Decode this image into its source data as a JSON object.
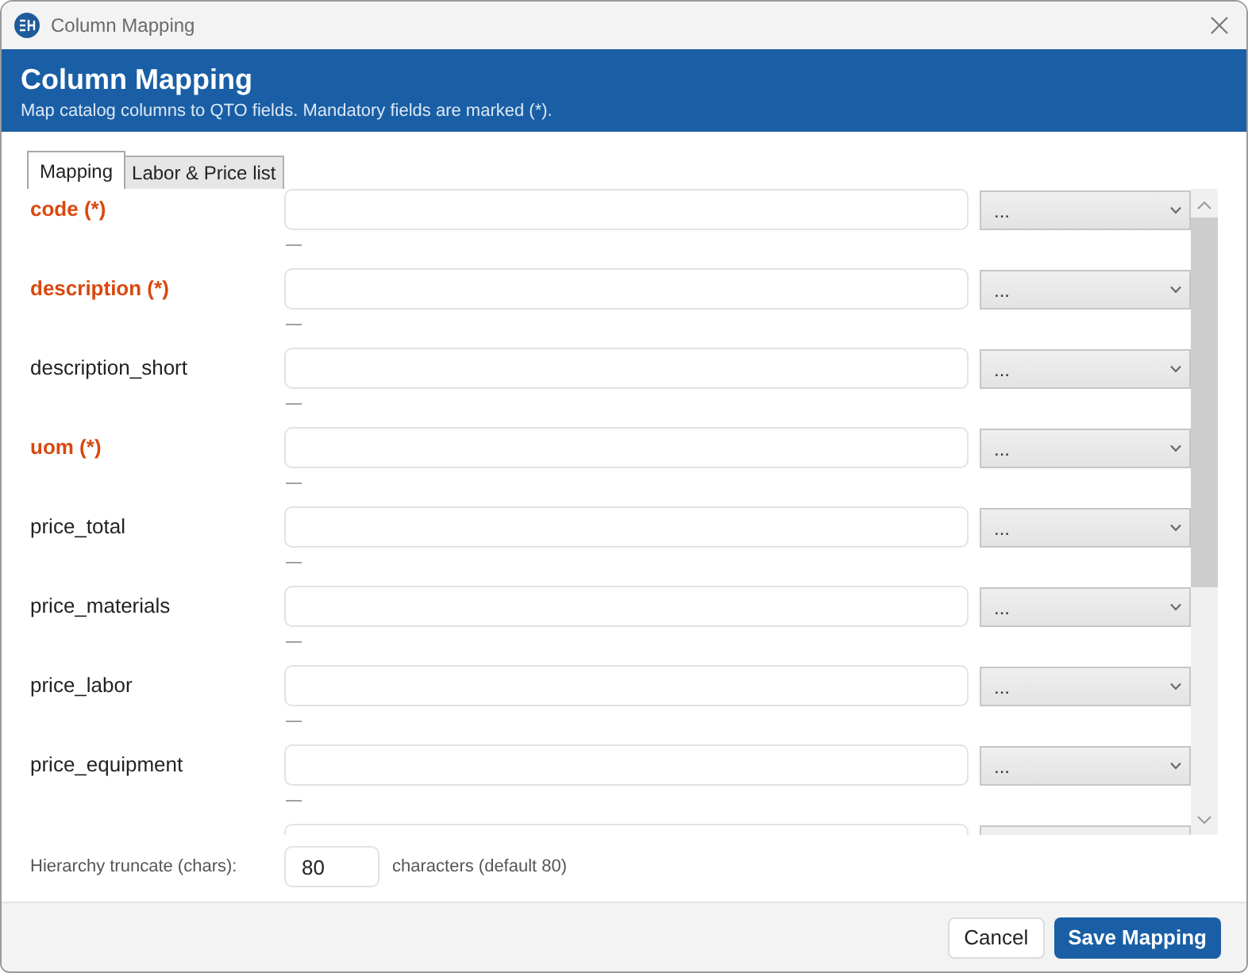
{
  "window": {
    "title": "Column Mapping"
  },
  "header": {
    "title": "Column Mapping",
    "subtitle": "Map catalog columns to QTO fields. Mandatory fields are marked (*)."
  },
  "tabs": [
    {
      "label": "Mapping",
      "selected": true
    },
    {
      "label": "Labor & Price list",
      "selected": false
    }
  ],
  "fields": [
    {
      "label": "code (*)",
      "required": true,
      "source": "...",
      "hint": "—"
    },
    {
      "label": "description (*)",
      "required": true,
      "source": "...",
      "hint": "—"
    },
    {
      "label": "description_short",
      "required": false,
      "source": "...",
      "hint": "—"
    },
    {
      "label": "uom (*)",
      "required": true,
      "source": "...",
      "hint": "—"
    },
    {
      "label": "price_total",
      "required": false,
      "source": "...",
      "hint": "—"
    },
    {
      "label": "price_materials",
      "required": false,
      "source": "...",
      "hint": "—"
    },
    {
      "label": "price_labor",
      "required": false,
      "source": "...",
      "hint": "—"
    },
    {
      "label": "price_equipment",
      "required": false,
      "source": "...",
      "hint": "—"
    }
  ],
  "truncate": {
    "label": "Hierarchy truncate (chars):",
    "value": "80",
    "suffix": "characters (default 80)"
  },
  "buttons": [
    {
      "label": "Cancel",
      "kind": "secondary"
    },
    {
      "label": "Save Mapping",
      "kind": "primary"
    }
  ]
}
